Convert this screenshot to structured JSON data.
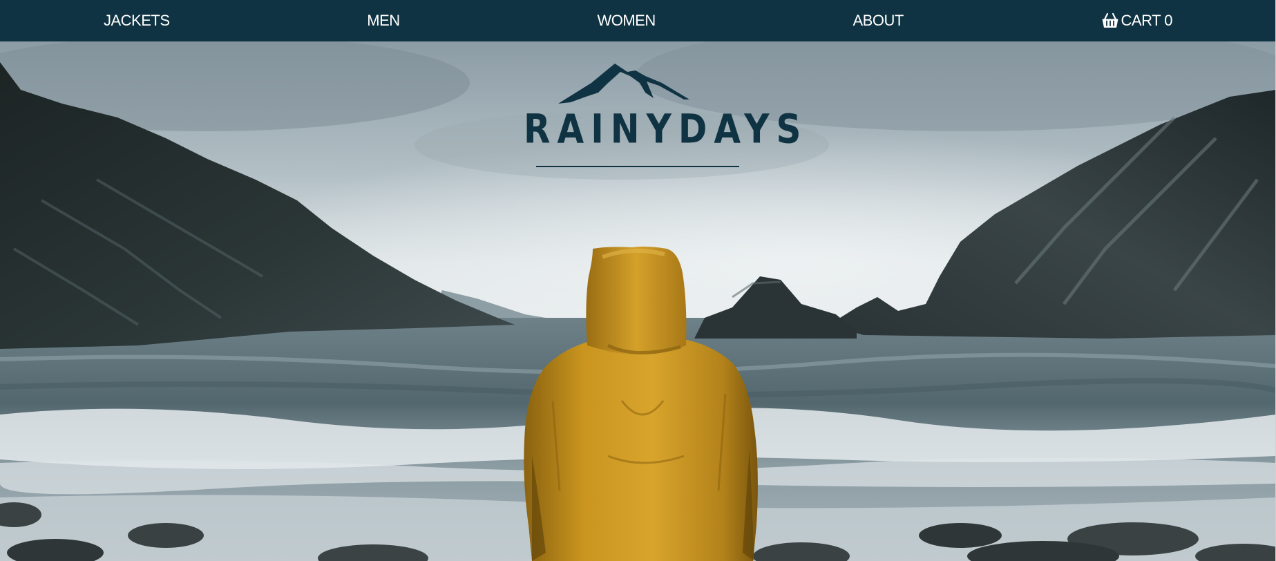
{
  "nav": {
    "items": [
      {
        "label": "JACKETS"
      },
      {
        "label": "MEN"
      },
      {
        "label": "WOMEN"
      },
      {
        "label": "ABOUT"
      }
    ],
    "cart": {
      "label": "CART 0",
      "icon": "basket-icon"
    }
  },
  "brand": {
    "name": "RAINYDAYS",
    "icon": "mountain-icon"
  },
  "colors": {
    "nav_bg": "#0f3342",
    "brand": "#0f3342",
    "jacket": "#c9951f"
  }
}
